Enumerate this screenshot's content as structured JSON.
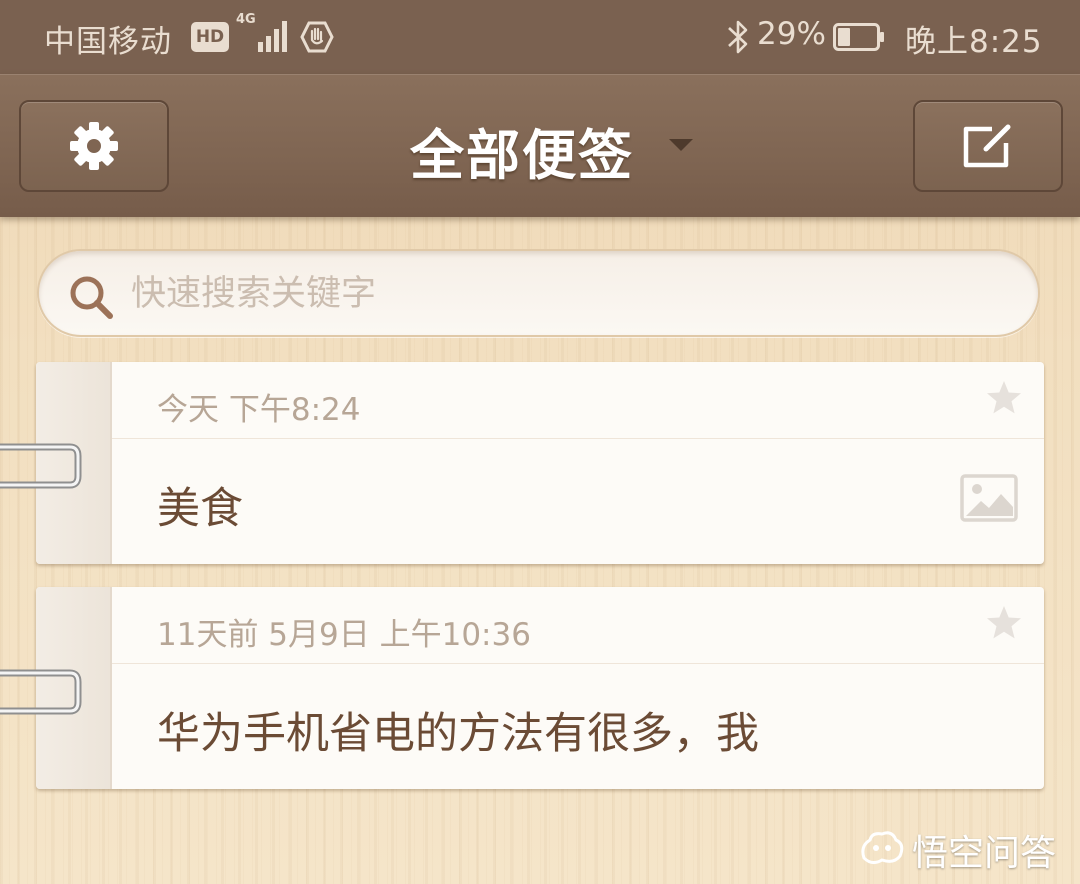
{
  "status_bar": {
    "carrier": "中国移动",
    "hd_badge": "HD",
    "network_type": "4G",
    "battery_percent": "29%",
    "time": "晚上8:25"
  },
  "header": {
    "title": "全部便签",
    "settings_icon": "gear-icon",
    "compose_icon": "compose-icon"
  },
  "search": {
    "placeholder": "快速搜索关键字",
    "value": ""
  },
  "notes": [
    {
      "date": "今天 下午8:24",
      "title": "美食",
      "starred": false,
      "has_image": true
    },
    {
      "date": "11天前 5月9日 上午10:36",
      "title": "华为手机省电的方法有很多，我",
      "starred": false,
      "has_image": false
    }
  ],
  "watermark": {
    "text": "悟空问答"
  },
  "colors": {
    "header_brown": "#7f6552",
    "status_brown": "#7a6150",
    "note_title": "#6b4b35",
    "note_date": "#b7a696",
    "wood_background": "#f2dfc0"
  }
}
